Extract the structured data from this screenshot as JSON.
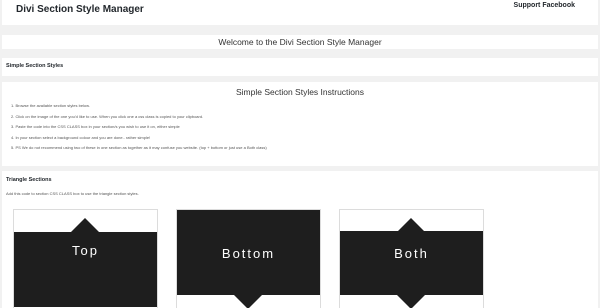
{
  "header": {
    "title": "Divi Section Style Manager",
    "support_label": "Support Facebook"
  },
  "welcome": {
    "text": "Welcome to the Divi Section Style Manager"
  },
  "simple_section": {
    "label": "Simple Section Styles"
  },
  "instructions": {
    "title": "Simple Section Styles Instructions",
    "steps": [
      "1. Browse the available section styles below.",
      "2. Click on the image of the one you'd like to use. When you click one a css class is copied to your clipboard.",
      "3. Paste the code into the CSS CLASS box in your section/s you wish to use it on, either simple",
      "4. In your section select a background colour and you are done.. rather simple!",
      "5. PS We do not recommend using two of these in one section as together as it may confuse you website. (top + bottom or just use a Both class)"
    ]
  },
  "triangle": {
    "heading": "Triangle Sections",
    "description": "Add this code to section CSS CLASS box to use the triangle section styles.",
    "cards": [
      {
        "label": "Top"
      },
      {
        "label": "Bottom"
      },
      {
        "label": "Both"
      }
    ]
  },
  "colors": {
    "background": "#f1f1f1",
    "panel": "#ffffff",
    "card_dark": "#1e1e1e"
  }
}
